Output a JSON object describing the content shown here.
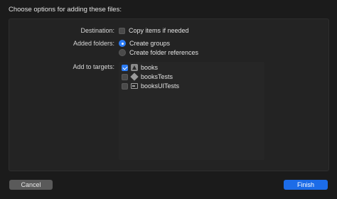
{
  "dialog": {
    "title": "Choose options for adding these files:"
  },
  "destination": {
    "label": "Destination:",
    "checkbox_label": "Copy items if needed",
    "checked": false
  },
  "added_folders": {
    "label": "Added folders:",
    "options": [
      {
        "label": "Create groups",
        "selected": true
      },
      {
        "label": "Create folder references",
        "selected": false
      }
    ]
  },
  "targets": {
    "label": "Add to targets:",
    "items": [
      {
        "name": "books",
        "icon": "app-target-icon",
        "checked": true
      },
      {
        "name": "booksTests",
        "icon": "unit-test-target-icon",
        "checked": false
      },
      {
        "name": "booksUITests",
        "icon": "ui-test-target-icon",
        "checked": false
      }
    ]
  },
  "buttons": {
    "cancel": "Cancel",
    "finish": "Finish"
  },
  "colors": {
    "accent": "#2c7cf6",
    "background": "#1b1b1b"
  }
}
